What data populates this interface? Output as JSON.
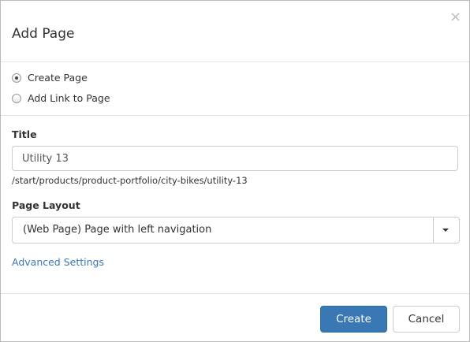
{
  "dialog": {
    "title": "Add Page",
    "close_glyph": "×"
  },
  "link_type": {
    "options": [
      {
        "label": "Create Page",
        "checked": true
      },
      {
        "label": "Add Link to Page",
        "checked": false
      }
    ]
  },
  "title_field": {
    "label": "Title",
    "value": "Utility 13",
    "path": "/start/products/product-portfolio/city-bikes/utility-13"
  },
  "layout_field": {
    "label": "Page Layout",
    "selected": "(Web Page) Page with left navigation"
  },
  "advanced_link": "Advanced Settings",
  "footer": {
    "create_label": "Create",
    "cancel_label": "Cancel"
  },
  "colors": {
    "primary": "#3a78b5",
    "link": "#3a76b3"
  },
  "icons": {
    "close": "close-icon",
    "dropdown": "caret-down-icon"
  }
}
